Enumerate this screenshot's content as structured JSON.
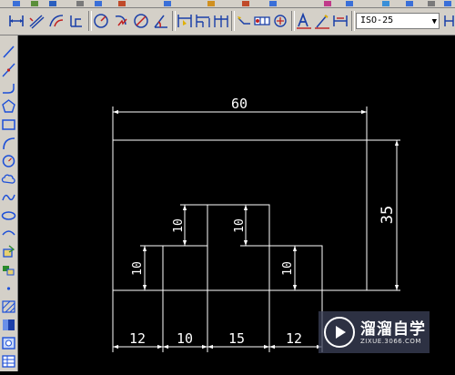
{
  "dim_style": {
    "value": "ISO-25"
  },
  "drawing": {
    "dimensions": {
      "overall_width": "60",
      "overall_height": "35",
      "step_left": "10",
      "step_center": "10",
      "step_center_right": "10",
      "step_right": "10",
      "seg1": "12",
      "seg2": "10",
      "seg3": "15",
      "seg4": "12"
    }
  },
  "watermark": {
    "title": "溜溜自学",
    "subtitle": "ZIXUE.3066.COM"
  },
  "colors": {
    "canvas_bg": "#000000",
    "line": "#ffffff",
    "chrome": "#d4d0c8",
    "left_icon_blue": "#1c4fd8"
  }
}
